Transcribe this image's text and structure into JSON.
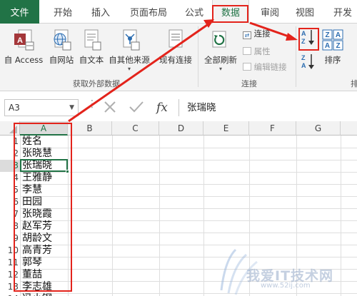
{
  "tabs": [
    {
      "label": "文件"
    },
    {
      "label": "开始"
    },
    {
      "label": "插入"
    },
    {
      "label": "页面布局"
    },
    {
      "label": "公式"
    },
    {
      "label": "数据"
    },
    {
      "label": "审阅"
    },
    {
      "label": "视图"
    },
    {
      "label": "开发"
    }
  ],
  "ribbon": {
    "get_external": {
      "access": "自 Access",
      "web": "自网站",
      "text": "自文本",
      "other": "自其他来源",
      "existing": "现有连接",
      "group_label": "获取外部数据"
    },
    "connections": {
      "refresh_all": "全部刷新",
      "connections": "连接",
      "properties": "属性",
      "edit_links": "编辑链接",
      "group_label": "连接"
    },
    "sort": {
      "sort": "排序",
      "group_label": "排"
    }
  },
  "formula_bar": {
    "name_box": "A3",
    "content": "张瑞晓"
  },
  "grid": {
    "columns": [
      "A",
      "B",
      "C",
      "D",
      "E",
      "F",
      "G"
    ],
    "rows": [
      {
        "num": "1",
        "a": "姓名"
      },
      {
        "num": "2",
        "a": "张晓慧"
      },
      {
        "num": "3",
        "a": "张瑞晓"
      },
      {
        "num": "4",
        "a": "王雅静"
      },
      {
        "num": "5",
        "a": "李慧"
      },
      {
        "num": "6",
        "a": "田园"
      },
      {
        "num": "7",
        "a": "张晓霞"
      },
      {
        "num": "8",
        "a": "赵军芳"
      },
      {
        "num": "9",
        "a": "胡龄文"
      },
      {
        "num": "10",
        "a": "高青芳"
      },
      {
        "num": "11",
        "a": "郭琴"
      },
      {
        "num": "12",
        "a": "董喆"
      },
      {
        "num": "13",
        "a": "李志雄"
      },
      {
        "num": "14",
        "a": "冯小钢"
      }
    ]
  },
  "watermark": {
    "text": "我爱IT技术网",
    "url": "www.52ij.com"
  },
  "colors": {
    "excel_green": "#217346",
    "annotation_red": "#e3231b",
    "ribbon_bg": "#f3f3f3"
  }
}
